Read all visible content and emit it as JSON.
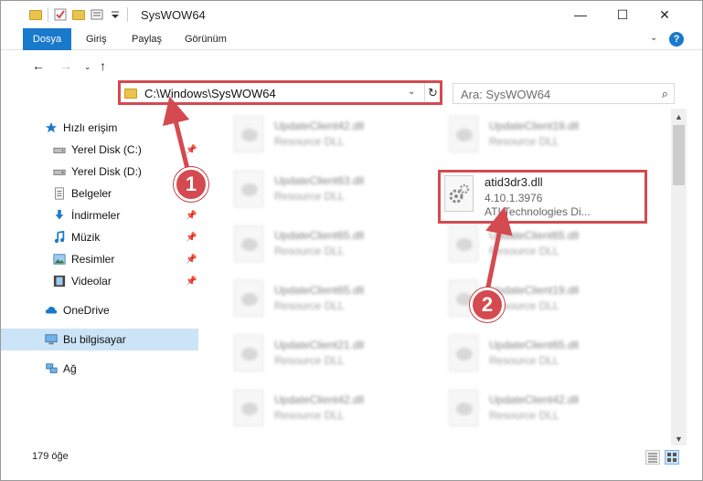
{
  "window": {
    "title": "SysWOW64"
  },
  "controls": {
    "minimize": "—",
    "maximize": "☐",
    "close": "✕"
  },
  "ribbon": {
    "tabs": [
      "Dosya",
      "Giriş",
      "Paylaş",
      "Görünüm"
    ],
    "help": "?"
  },
  "address": {
    "path": "C:\\Windows\\SysWOW64"
  },
  "search": {
    "placeholder": "Ara: SysWOW64"
  },
  "sidebar": {
    "items": [
      {
        "label": "Hızlı erişim",
        "icon": "star-icon"
      },
      {
        "label": "Yerel Disk (C:)",
        "icon": "drive-icon",
        "pinned": true
      },
      {
        "label": "Yerel Disk (D:)",
        "icon": "drive-icon",
        "pinned": true
      },
      {
        "label": "Belgeler",
        "icon": "documents-icon",
        "pinned": true
      },
      {
        "label": "İndirmeler",
        "icon": "download-icon",
        "pinned": true
      },
      {
        "label": "Müzik",
        "icon": "music-icon",
        "pinned": true
      },
      {
        "label": "Resimler",
        "icon": "pictures-icon",
        "pinned": true
      },
      {
        "label": "Videolar",
        "icon": "video-icon",
        "pinned": true
      },
      {
        "label": "OneDrive",
        "icon": "cloud-icon"
      },
      {
        "label": "Bu bilgisayar",
        "icon": "computer-icon",
        "selected": true
      },
      {
        "label": "Ağ",
        "icon": "network-icon"
      }
    ]
  },
  "files": {
    "left_column": [
      {
        "name": "UpdateClient42.dll",
        "type": "Resource DLL"
      },
      {
        "name": "UpdateClient63.dll",
        "type": "Resource DLL"
      },
      {
        "name": "UpdateClient65.dll",
        "type": "Resource DLL"
      },
      {
        "name": "UpdateClient65.dll",
        "type": "Resource DLL"
      },
      {
        "name": "UpdateClient21.dll",
        "type": "Resource DLL"
      },
      {
        "name": "UpdateClient42.dll",
        "type": "Resource DLL"
      }
    ],
    "right_column": [
      {
        "name": "UpdateClient19.dll",
        "type": "Resource DLL"
      },
      {
        "name": "UpdateClient65.dll",
        "type": "Resource DLL"
      },
      {
        "name": "UpdateClient19.dll",
        "type": "Resource DLL"
      },
      {
        "name": "UpdateClient65.dll",
        "type": "Resource DLL"
      },
      {
        "name": "UpdateClient42.dll",
        "type": "Resource DLL"
      }
    ],
    "selected": {
      "name": "atid3dr3.dll",
      "version": "4.10.1.3976",
      "company": "ATI Technologies Di..."
    }
  },
  "status": {
    "count": "179 öğe"
  },
  "callouts": [
    "1",
    "2"
  ],
  "colors": {
    "accent": "#1979ca",
    "highlight": "#d44a50",
    "selection": "#cce4f7",
    "folder": "#e8c34d"
  }
}
